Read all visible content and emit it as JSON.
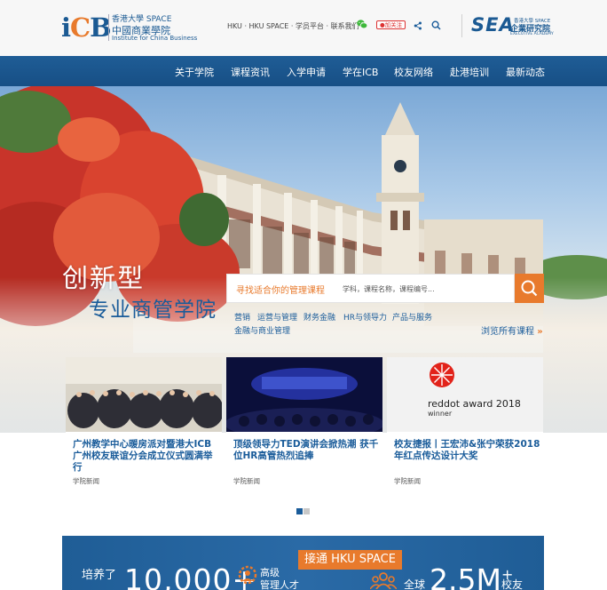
{
  "header": {
    "logo_icb": {
      "mark": "iCB",
      "line1": "香港大學 SPACE",
      "line2": "中國商業學院",
      "line3": "Institute for China Business"
    },
    "top_links": "HKU · HKU SPACE · 学员平台 · 联系我们",
    "follow_badge": "加关注",
    "icons": [
      "wechat-icon",
      "weibo-icon",
      "share-icon",
      "search-icon"
    ],
    "logo_sea": {
      "mark": "SEA",
      "line1": "香港大學 SPACE",
      "line2": "企業研究院",
      "line3": "EXECUTIVE ACADEMY"
    }
  },
  "nav": {
    "items": [
      "关于学院",
      "课程资讯",
      "入学申请",
      "学在ICB",
      "校友网络",
      "赴港培训",
      "最新动态"
    ]
  },
  "hero": {
    "slogan_line1": "创新型",
    "slogan_line2": "专业商管学院",
    "search": {
      "label": "寻找适合你的管理课程",
      "placeholder": "学科，课程名称，课程编号..."
    },
    "categories": [
      "营销",
      "运营与管理",
      "财务金融",
      "HR与领导力",
      "产品与服务",
      "金融与商业管理"
    ],
    "browse_all": "浏览所有课程",
    "browse_arrow": "»"
  },
  "news": [
    {
      "title": "广州教学中心暖房派对暨港大ICB广州校友联谊分会成立仪式圆满举行",
      "tag": "学院新闻"
    },
    {
      "title": "顶级领导力TED演讲会掀热潮 获千位HR高管热烈追捧",
      "tag": "学院新闻"
    },
    {
      "title": "校友捷报丨王宏沛&张宁荣获2018年红点传达设计大奖",
      "tag": "学院新闻",
      "image_text_1": "reddot award 2018",
      "image_text_2": "winner"
    }
  ],
  "carousel": {
    "active": 1,
    "count": 2
  },
  "stats": {
    "cultivated": "培养了",
    "count_talent": "10,000+",
    "talent_line1": "高级",
    "talent_line2": "管理人才",
    "connect": "接通 HKU SPACE",
    "global": "全球",
    "count_alumni": "2.5M",
    "plus": "+",
    "alumni": "校友"
  },
  "colors": {
    "brand_blue": "#1a5c9a",
    "accent_orange": "#e87a2c",
    "nav_blue": "#1f5d96"
  }
}
